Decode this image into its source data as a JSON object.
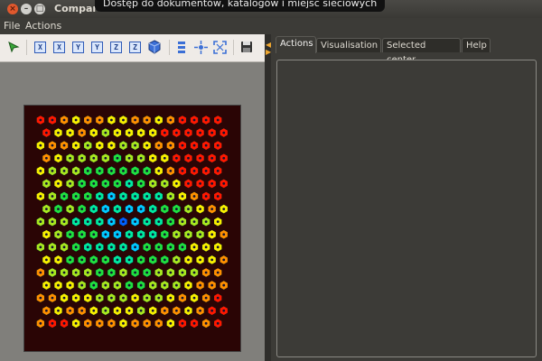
{
  "window": {
    "title": "Compartment viewer"
  },
  "tooltip": {
    "text": "Dostęp do dokumentów, katalogów i miejsc sieciowych"
  },
  "menubar": {
    "file": "File",
    "actions": "Actions"
  },
  "toolbar": {
    "axis_buttons": [
      "X",
      "X",
      "Y",
      "Y",
      "Z",
      "Z"
    ],
    "icons": [
      "select-arrow-icon",
      "axis-x-icon",
      "axis-x-icon",
      "axis-y-icon",
      "axis-y-icon",
      "axis-z-icon",
      "axis-z-icon",
      "cube-3d-icon",
      "layers-icon",
      "center-target-icon",
      "fit-view-icon",
      "save-disk-icon"
    ]
  },
  "tabs": [
    {
      "label": "Actions",
      "active": true
    },
    {
      "label": "Visualisation",
      "active": false
    },
    {
      "label": "Selected center",
      "active": false
    },
    {
      "label": "Help",
      "active": false
    }
  ],
  "grid": {
    "rows": 17,
    "cols": 16,
    "colormap": [
      "#0000c8",
      "#0060ff",
      "#00c8ff",
      "#00e8a0",
      "#20e040",
      "#a8e820",
      "#f8f000",
      "#ff9000",
      "#ff1800"
    ]
  }
}
